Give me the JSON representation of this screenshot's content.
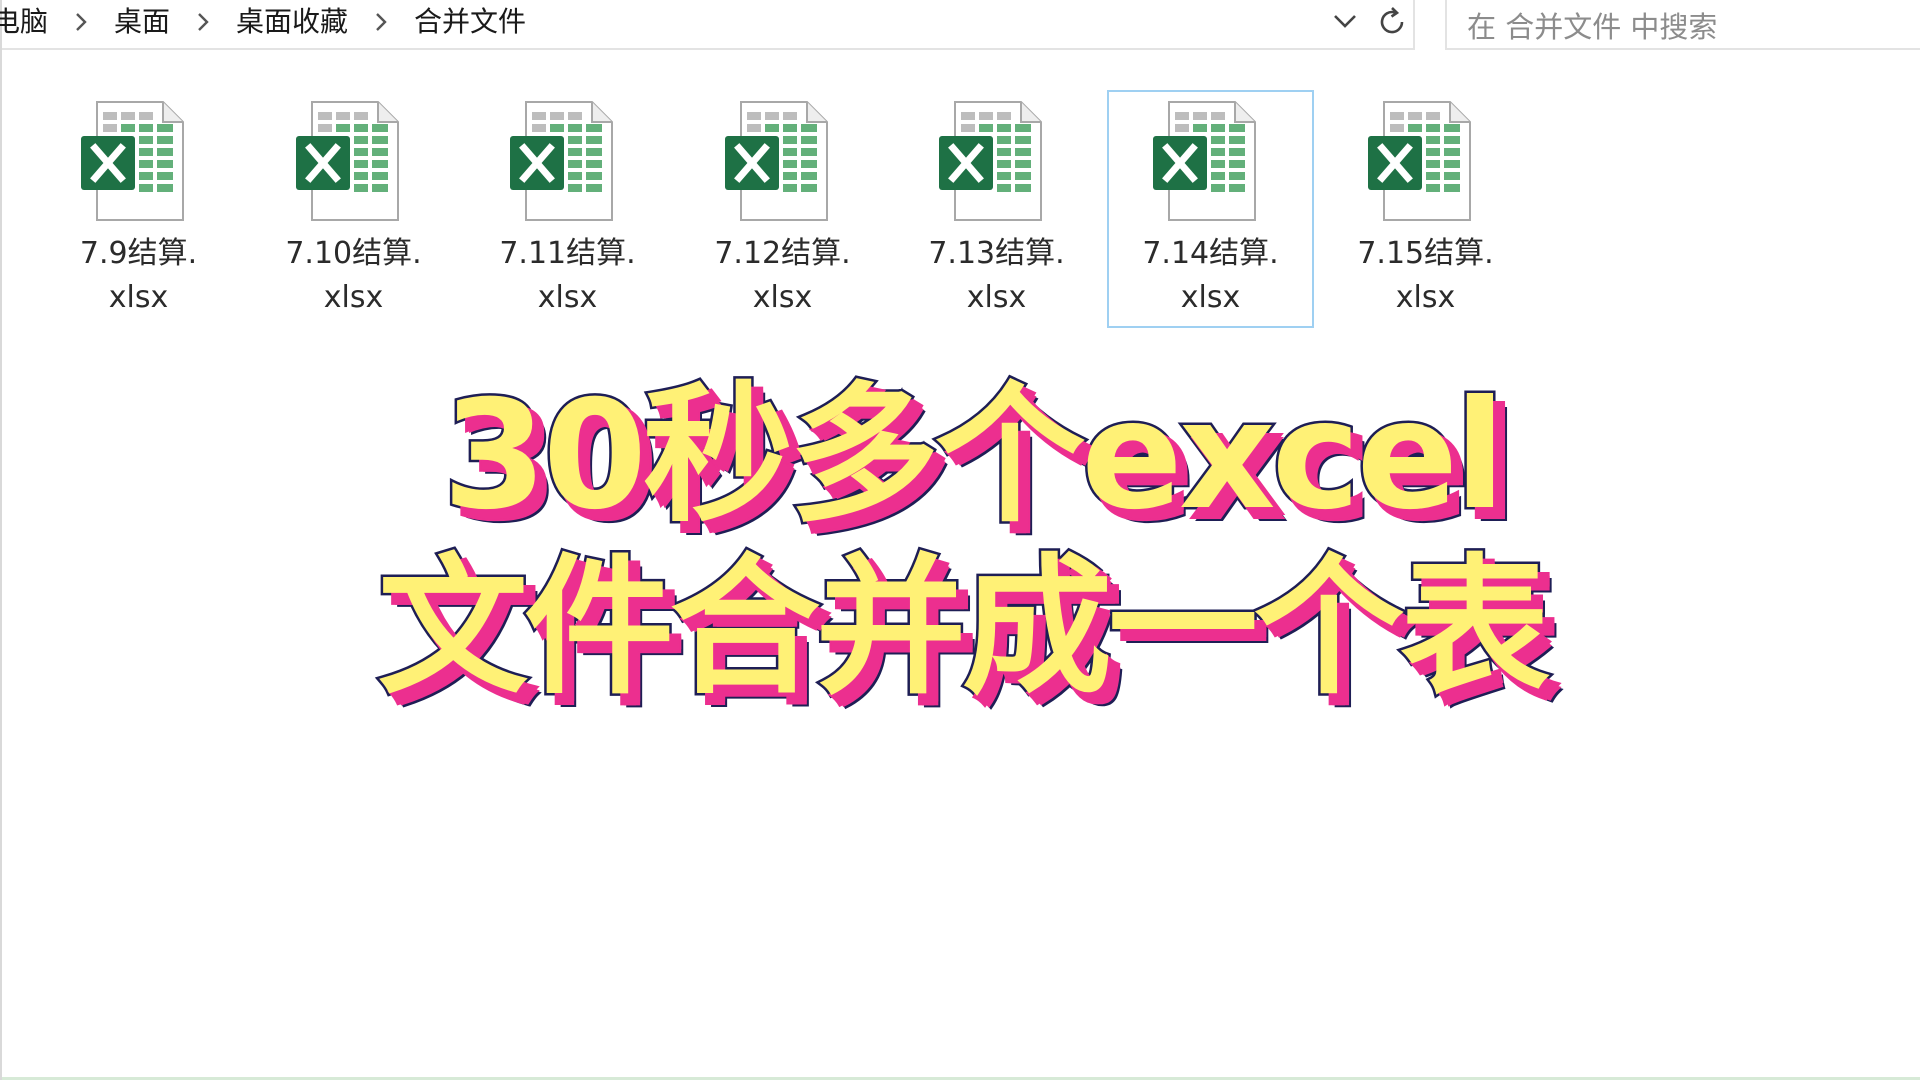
{
  "breadcrumb": {
    "items": [
      "电脑",
      "桌面",
      "桌面收藏",
      "合并文件"
    ]
  },
  "search": {
    "placeholder": "在 合并文件 中搜索"
  },
  "files": [
    {
      "name_line1": "7.9结算.",
      "name_line2": "xlsx",
      "selected": false
    },
    {
      "name_line1": "7.10结算.",
      "name_line2": "xlsx",
      "selected": false
    },
    {
      "name_line1": "7.11结算.",
      "name_line2": "xlsx",
      "selected": false
    },
    {
      "name_line1": "7.12结算.",
      "name_line2": "xlsx",
      "selected": false
    },
    {
      "name_line1": "7.13结算.",
      "name_line2": "xlsx",
      "selected": false
    },
    {
      "name_line1": "7.14结算.",
      "name_line2": "xlsx",
      "selected": true
    },
    {
      "name_line1": "7.15结算.",
      "name_line2": "xlsx",
      "selected": false
    }
  ],
  "icons": {
    "file": "excel-file-icon",
    "separator": "chevron-right-icon",
    "dropdown": "chevron-down-icon",
    "refresh": "refresh-icon"
  },
  "overlay": {
    "line1": "30秒多个excel",
    "line2": "文件合并成一个表"
  },
  "colors": {
    "excel_green": "#1e7145",
    "excel_light_green": "#63b07a",
    "selection_border": "#9fd0f2",
    "title_fill": "#fff176",
    "title_shadow": "#ec2f8f",
    "title_outline": "#1e1e55"
  }
}
